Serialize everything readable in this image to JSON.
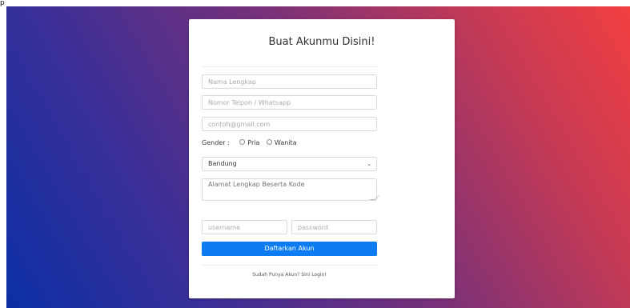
{
  "corner": {
    "text": "p"
  },
  "form": {
    "title": "Buat Akunmu Disini!",
    "full_name_placeholder": "Nama Lengkap",
    "phone_placeholder": "Nomor Telpon / Whatsapp",
    "email_placeholder": "contoh@gmail.com",
    "gender_label": "Gender :",
    "gender_options": [
      "Pria",
      "Wanita"
    ],
    "city_selected": "Bandung",
    "address_placeholder": "Alamat Lengkap Beserta Kode",
    "username_placeholder": "username",
    "password_placeholder": "password",
    "submit_label": "Daftarkan Akun",
    "login_prompt": "Sudah Punya Akun? Sini Login!"
  },
  "colors": {
    "primary_button": "#0d7bf2",
    "gradient_start": "#0b2fa6",
    "gradient_end": "#f23f40"
  }
}
